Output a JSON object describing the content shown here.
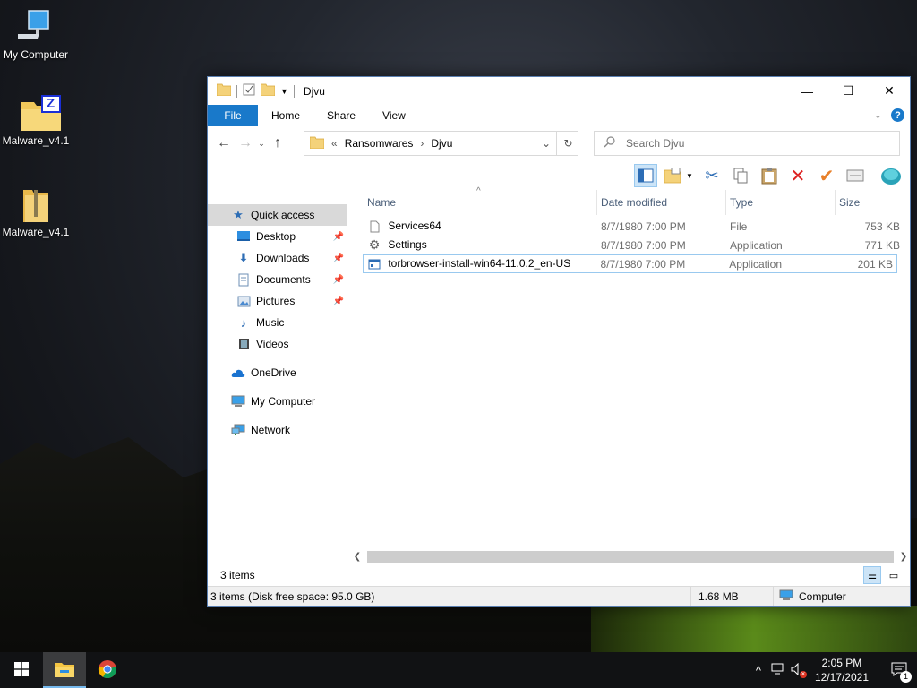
{
  "desktop": {
    "icons": [
      {
        "label": "My Computer"
      },
      {
        "label": "Malware_v4.1",
        "badge": "Z"
      },
      {
        "label": "Malware_v4.1"
      }
    ]
  },
  "window": {
    "title": "Djvu",
    "controls": {
      "minimize": "—",
      "maximize": "☐",
      "close": "✕"
    },
    "ribbon": {
      "file": "File",
      "tabs": [
        "Home",
        "Share",
        "View"
      ],
      "help": "?"
    },
    "nav": {
      "breadcrumb_prefix": "«",
      "breadcrumb": [
        "Ransomwares",
        "Djvu"
      ],
      "search_placeholder": "Search Djvu"
    },
    "navpane": {
      "quick_access": "Quick access",
      "pinned": [
        "Desktop",
        "Downloads",
        "Documents",
        "Pictures"
      ],
      "unpinned": [
        "Music",
        "Videos"
      ],
      "onedrive": "OneDrive",
      "my_computer": "My Computer",
      "network": "Network"
    },
    "columns": {
      "name": "Name",
      "date": "Date modified",
      "type": "Type",
      "size": "Size"
    },
    "files": [
      {
        "name": "Services64",
        "date": "8/7/1980 7:00 PM",
        "type": "File",
        "size": "753 KB",
        "icon": "blank-file-icon"
      },
      {
        "name": "Settings",
        "date": "8/7/1980 7:00 PM",
        "type": "Application",
        "size": "771 KB",
        "icon": "gear-icon"
      },
      {
        "name": "torbrowser-install-win64-11.0.2_en-US",
        "date": "8/7/1980 7:00 PM",
        "type": "Application",
        "size": "201 KB",
        "icon": "app-icon"
      }
    ],
    "items_count": "3 items",
    "status": {
      "summary": "3 items (Disk free space: 95.0 GB)",
      "size": "1.68 MB",
      "location": "Computer"
    }
  },
  "taskbar": {
    "time": "2:05 PM",
    "date": "12/17/2021",
    "notification_count": "1"
  },
  "colors": {
    "accent": "#1979ca",
    "selection": "#cce4f7"
  }
}
